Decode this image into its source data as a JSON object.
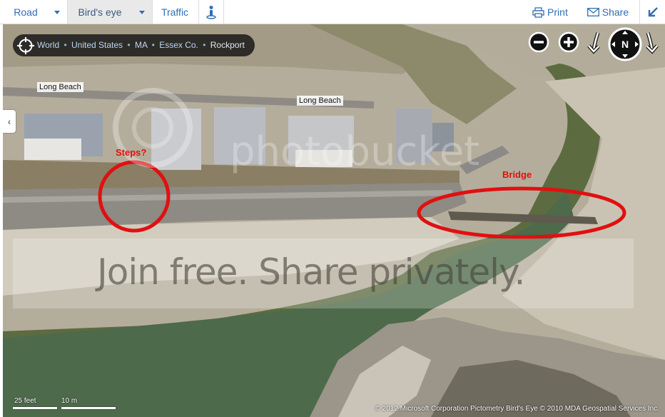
{
  "toolbar": {
    "road_label": "Road",
    "birds_eye_label": "Bird's eye",
    "traffic_label": "Traffic",
    "print_label": "Print",
    "share_label": "Share",
    "icons": {
      "road_dropdown": "chevron-down-icon",
      "birds_eye_dropdown": "chevron-down-icon",
      "streetside": "person-icon",
      "print": "printer-icon",
      "share": "envelope-icon",
      "collapse": "arrow-down-left-icon"
    }
  },
  "breadcrumb": {
    "items": [
      "World",
      "United States",
      "MA",
      "Essex Co.",
      "Rockport"
    ],
    "separator": "•"
  },
  "map_controls": {
    "compass_label": "N",
    "icons": [
      "zoom-out-icon",
      "zoom-in-icon",
      "rotate-left-icon",
      "compass-icon",
      "rotate-right-icon"
    ]
  },
  "map": {
    "street_labels": [
      "Long Beach",
      "Long Beach"
    ],
    "annotations": {
      "steps": "Steps?",
      "bridge": "Bridge"
    },
    "watermark": "Join free. Share privately.",
    "watermark_logo": "photobucket",
    "scale": {
      "feet_label": "25 feet",
      "meters_label": "10 m"
    },
    "copyright": "© 2012 Microsoft Corporation   Pictometry Bird's Eye © 2010 MDA Geospatial Services Inc."
  },
  "colors": {
    "link": "#2f6fb5",
    "annotation": "#e01010",
    "toolbar_active": "#e9e9e9"
  }
}
